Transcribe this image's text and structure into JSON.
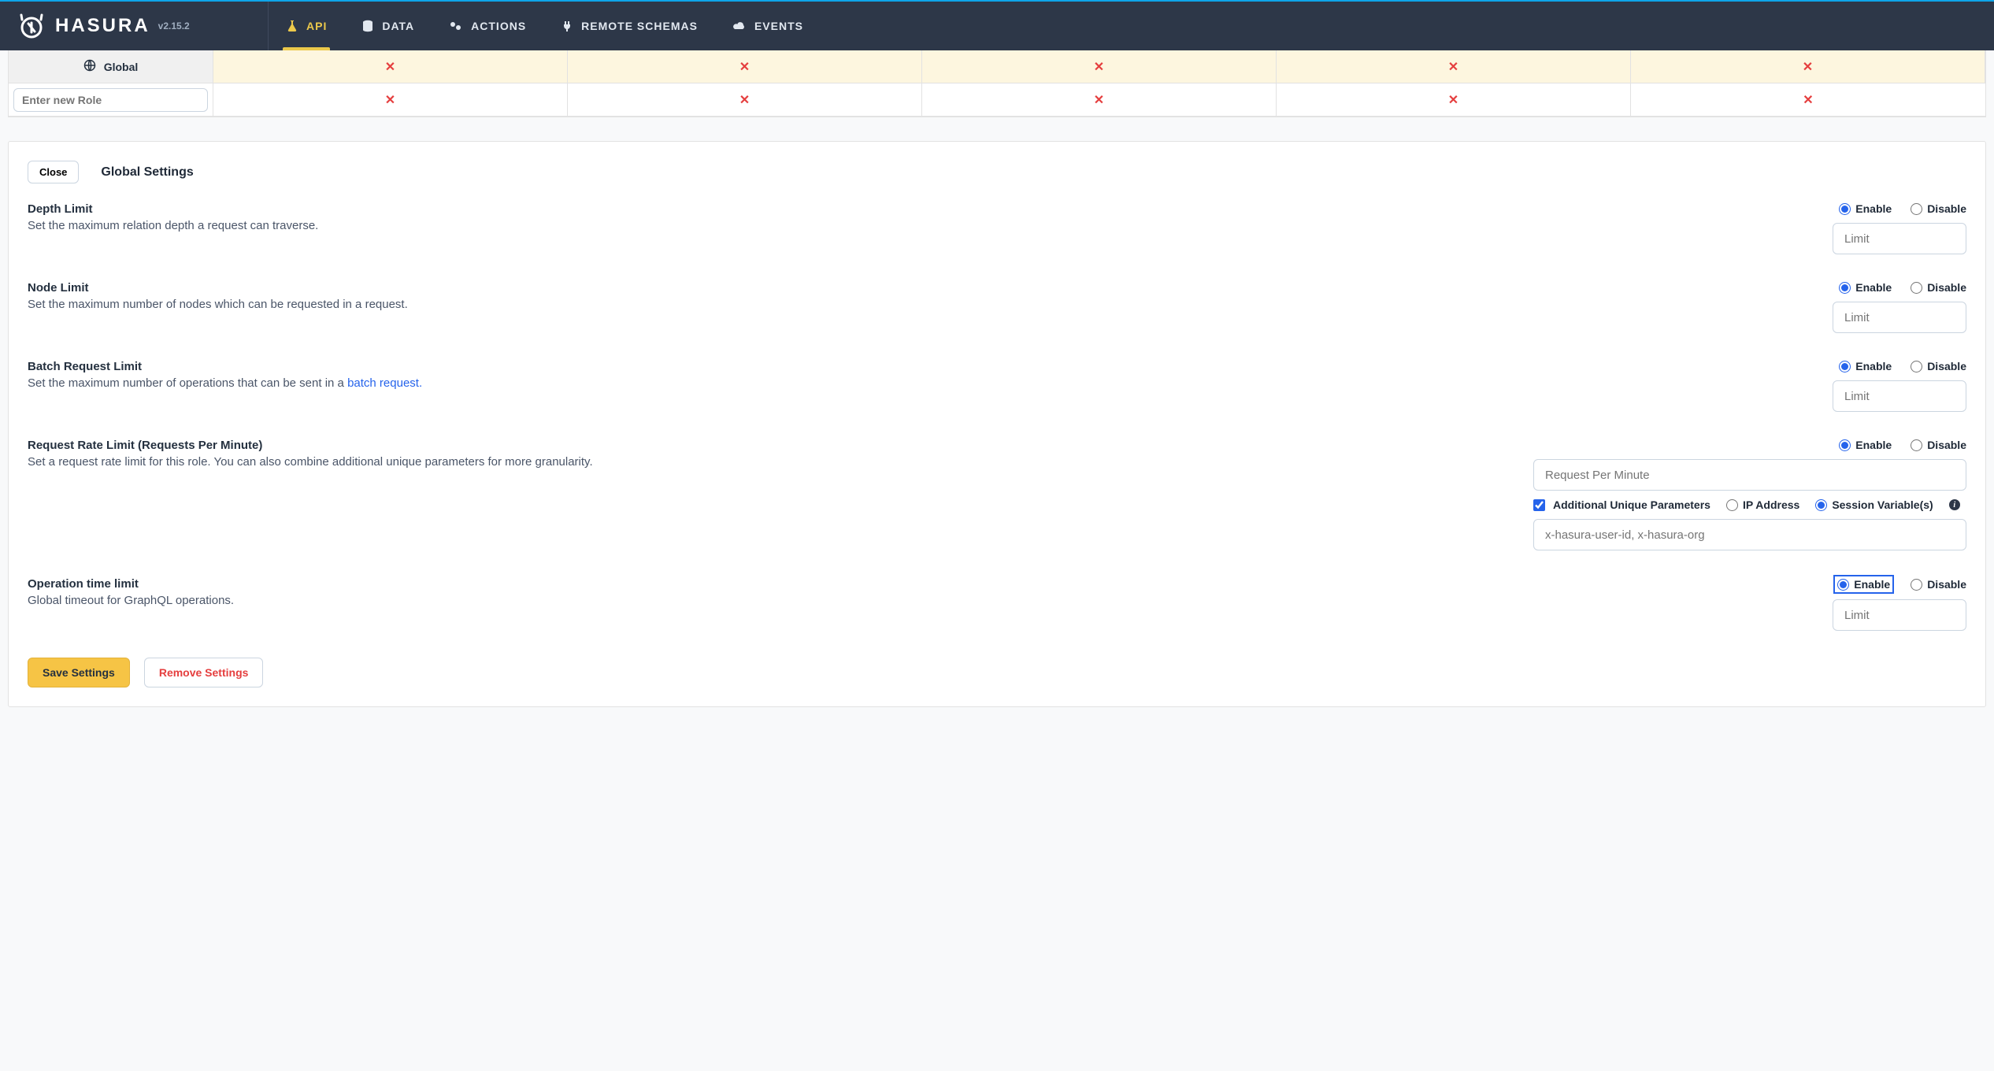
{
  "brand": {
    "name": "HASURA",
    "version": "v2.15.2"
  },
  "nav": {
    "api": "API",
    "data": "DATA",
    "actions": "ACTIONS",
    "remote_schemas": "REMOTE SCHEMAS",
    "events": "EVENTS"
  },
  "roles_table": {
    "global_label": "Global",
    "new_role_placeholder": "Enter new Role",
    "x_icon": "✕"
  },
  "card": {
    "close_label": "Close",
    "title": "Global Settings"
  },
  "settings": {
    "depth": {
      "title": "Depth Limit",
      "desc": "Set the maximum relation depth a request can traverse.",
      "enable": "Enable",
      "disable": "Disable",
      "placeholder": "Limit"
    },
    "node": {
      "title": "Node Limit",
      "desc": "Set the maximum number of nodes which can be requested in a request.",
      "enable": "Enable",
      "disable": "Disable",
      "placeholder": "Limit"
    },
    "batch": {
      "title": "Batch Request Limit",
      "desc_pre": "Set the maximum number of operations that can be sent in a ",
      "desc_link": "batch request.",
      "enable": "Enable",
      "disable": "Disable",
      "placeholder": "Limit"
    },
    "rate": {
      "title": "Request Rate Limit (Requests Per Minute)",
      "desc": "Set a request rate limit for this role. You can also combine additional unique parameters for more granularity.",
      "enable": "Enable",
      "disable": "Disable",
      "rpm_placeholder": "Request Per Minute",
      "aup_label": "Additional Unique Parameters",
      "ip_label": "IP Address",
      "session_label": "Session Variable(s)",
      "sv_placeholder": "x-hasura-user-id, x-hasura-org"
    },
    "optime": {
      "title": "Operation time limit",
      "desc": "Global timeout for GraphQL operations.",
      "enable": "Enable",
      "disable": "Disable",
      "placeholder": "Limit"
    }
  },
  "actions": {
    "save": "Save Settings",
    "remove": "Remove Settings"
  },
  "icons": {
    "flask": "lab-flask-icon",
    "database": "database-icon",
    "gears": "gears-icon",
    "plug": "plug-icon",
    "cloud": "cloud-icon",
    "globe": "globe-icon",
    "info": "info-icon"
  }
}
